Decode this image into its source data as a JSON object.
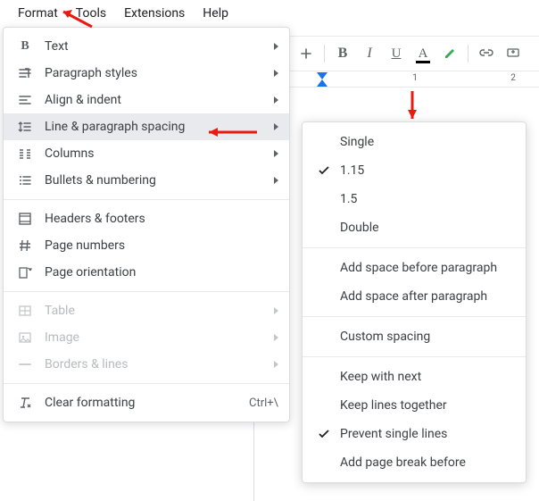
{
  "menubar": {
    "format": "Format",
    "tools": "Tools",
    "extensions": "Extensions",
    "help": "Help"
  },
  "format_menu": {
    "text": "Text",
    "paragraph_styles": "Paragraph styles",
    "align_indent": "Align & indent",
    "line_spacing": "Line & paragraph spacing",
    "columns": "Columns",
    "bullets_numbering": "Bullets & numbering",
    "headers_footers": "Headers & footers",
    "page_numbers": "Page numbers",
    "page_orientation": "Page orientation",
    "table": "Table",
    "image": "Image",
    "borders_lines": "Borders & lines",
    "clear_formatting": "Clear formatting",
    "clear_shortcut": "Ctrl+\\"
  },
  "spacing_menu": {
    "single": "Single",
    "v115": "1.15",
    "v15": "1.5",
    "double": "Double",
    "add_before": "Add space before paragraph",
    "add_after": "Add space after paragraph",
    "custom": "Custom spacing",
    "keep_next": "Keep with next",
    "keep_together": "Keep lines together",
    "prevent_single": "Prevent single lines",
    "page_break": "Add page break before"
  },
  "ruler": {
    "one": "1",
    "two": "2"
  },
  "toolbar_labels": {
    "bold": "B",
    "italic": "I",
    "underline": "U",
    "textcolor": "A"
  }
}
